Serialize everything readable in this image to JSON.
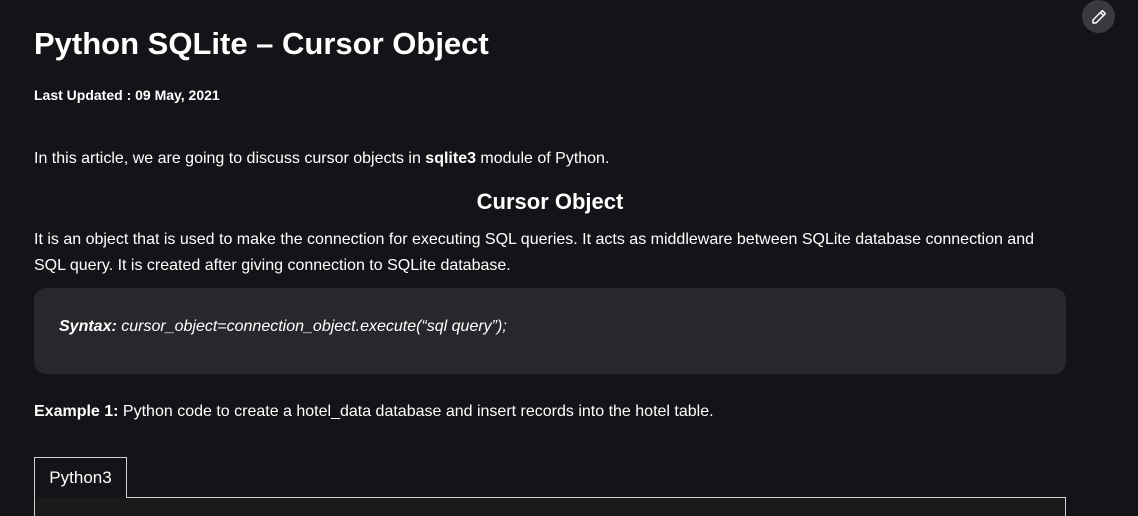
{
  "toolbar": {
    "edit_icon": "pencil-icon"
  },
  "article": {
    "title": "Python SQLite – Cursor Object",
    "last_updated": "Last Updated : 09 May, 2021",
    "intro_before": "In this article, we are going to discuss cursor objects in ",
    "intro_bold": "sqlite3",
    "intro_after": " module of Python.",
    "section_heading": "Cursor Object",
    "description": "It is an object that is used to make the connection for executing SQL queries. It acts as middleware between SQLite database connection and SQL query. It is created after giving connection to SQLite database.",
    "syntax_label": "Syntax:",
    "syntax_code": " cursor_object=connection_object.execute(“sql query”);",
    "example_label": "Example 1:",
    "example_text": " Python code to create a hotel_data database and insert records into the hotel table.",
    "code_tab": "Python3"
  },
  "colors": {
    "background": "#131417",
    "text": "#ffffff",
    "syntax_box": "#28282c",
    "edit_button": "#3a3a3e"
  }
}
